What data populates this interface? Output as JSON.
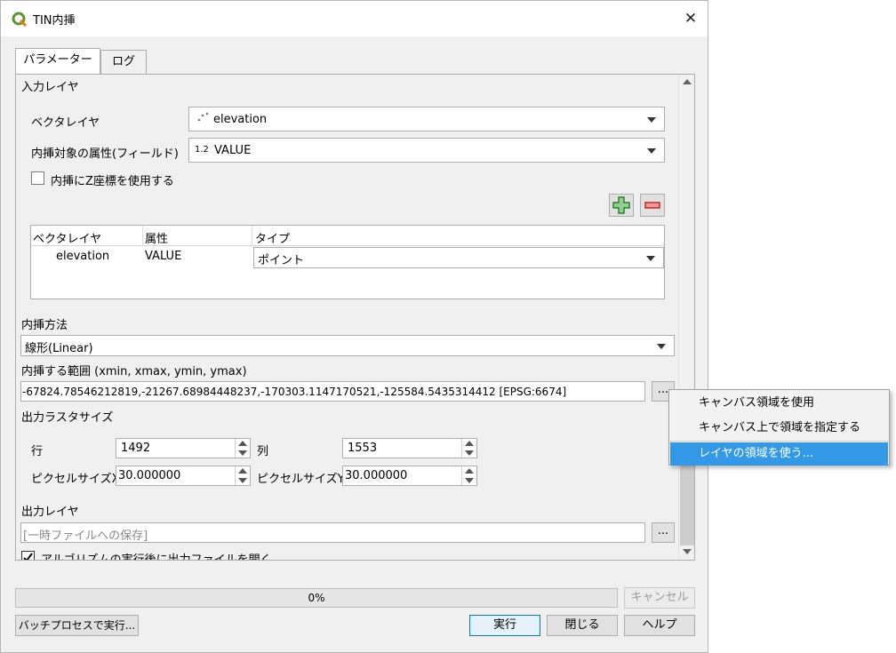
{
  "window": {
    "title": "TIN内挿"
  },
  "tabs": [
    {
      "label": "パラメーター"
    },
    {
      "label": "ログ"
    }
  ],
  "input_layer": {
    "section_label": "入力レイヤ",
    "vector_layer_label": "ベクタレイヤ",
    "vector_layer_value": "elevation",
    "attribute_label": "内挿対象の属性(フィールド)",
    "attribute_type_badge": "1.2",
    "attribute_value": "VALUE",
    "use_z_label": "内挿にZ座標を使用する",
    "table": {
      "headers": [
        "ベクタレイヤ",
        "属性",
        "タイプ"
      ],
      "rows": [
        {
          "layer": "elevation",
          "attribute": "VALUE",
          "type": "ポイント"
        }
      ]
    }
  },
  "interpolation": {
    "label": "内挿方法",
    "value": "線形(Linear)"
  },
  "extent": {
    "label": "内挿する範囲 (xmin, xmax, ymin, ymax)",
    "value": "-67824.78546212819,-21267.68984448237,-170303.1147170521,-125584.5435314412 [EPSG:6674]",
    "browse_label": "..."
  },
  "raster_size": {
    "label": "出力ラスタサイズ",
    "rows_label": "行",
    "rows_value": "1492",
    "cols_label": "列",
    "cols_value": "1553",
    "pixel_x_label": "ピクセルサイズX",
    "pixel_x_value": "30.000000",
    "pixel_y_label": "ピクセルサイズY",
    "pixel_y_value": "30.000000"
  },
  "output": {
    "label": "出力レイヤ",
    "placeholder": "[一時ファイルへの保存]",
    "browse_label": "...",
    "open_after_label": "アルゴリズムの実行後に出力ファイルを開く"
  },
  "progress": {
    "text": "0%",
    "value": 0,
    "cancel_label": "キャンセル"
  },
  "footer": {
    "batch_label": "バッチプロセスで実行...",
    "run_label": "実行",
    "close_label": "閉じる",
    "help_label": "ヘルプ"
  },
  "context_menu": {
    "items": [
      "キャンバス領域を使用",
      "キャンバス上で領域を指定する",
      "レイヤの領域を使う..."
    ],
    "selected_index": 2
  },
  "colors": {
    "qgis_green": "#589632",
    "menu_highlight": "#3399e6",
    "add_green": "#3c9a3c",
    "remove_red": "#d93a3a"
  }
}
